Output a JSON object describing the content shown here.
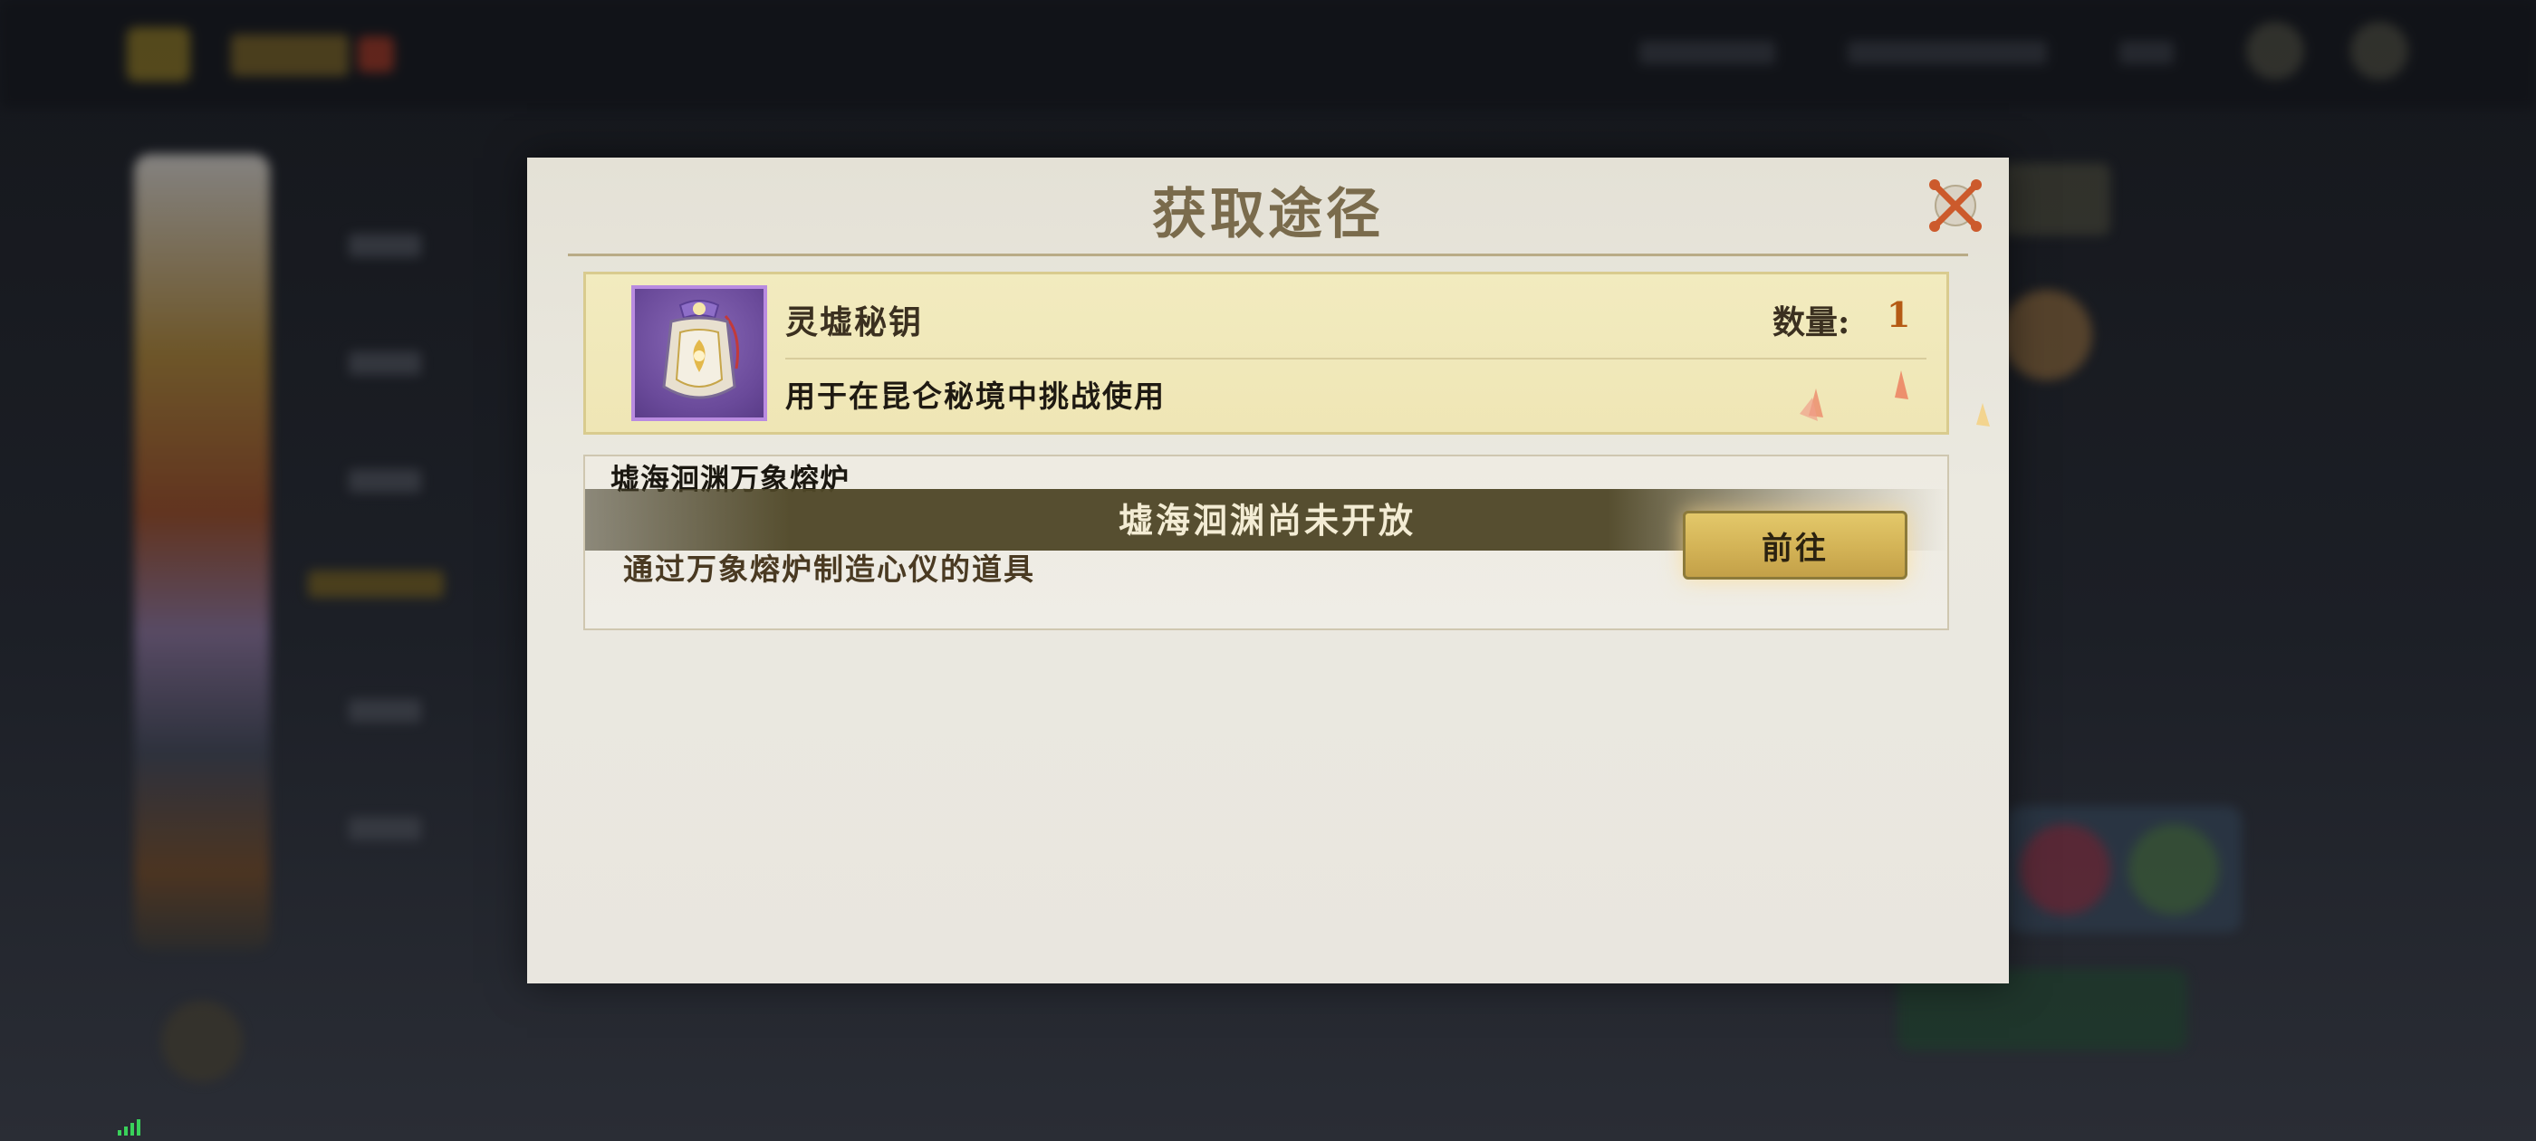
{
  "modal": {
    "title": "获取途径",
    "close_label": "close"
  },
  "item": {
    "name": "灵墟秘钥",
    "quantity_label": "数量:",
    "quantity_value": "1",
    "description": "用于在昆仑秘境中挑战使用",
    "icon": "key-pouch-icon"
  },
  "source": {
    "title": "墟海洄渊万象熔炉",
    "locked_message": "墟海洄渊尚未开放",
    "description": "通过万象熔炉制造心仪的道具",
    "go_button_label": "前往"
  },
  "colors": {
    "title": "#7a6b4c",
    "item_card_bg": "#f2ebbf",
    "quantity_accent": "#b55a14",
    "go_button": "#d3b356",
    "locked_banner": "#4e4626",
    "signal": "#39d15a"
  }
}
